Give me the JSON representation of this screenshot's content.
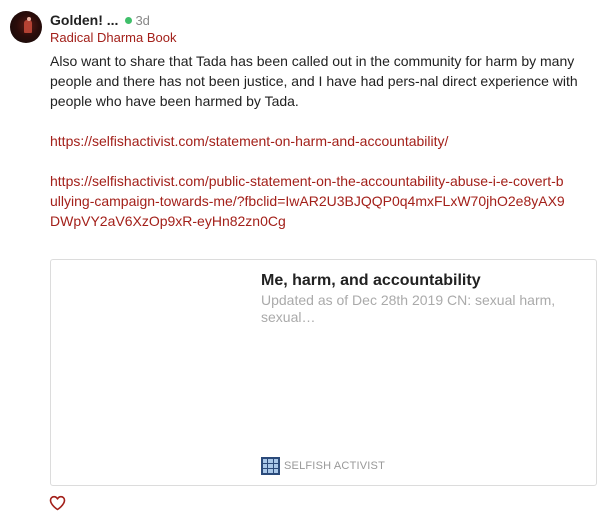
{
  "post": {
    "author": "Golden! ...",
    "time": "3d",
    "community": "Radical Dharma Book",
    "body": "Also want to share that Tada has been called out in the community for harm by many people and there has not been justice, and I have had pers-nal direct experience with people who have been harmed by Tada.",
    "links": [
      "https://selfishactivist.com/statement-on-harm-and-accountability/",
      "https://selfishactivist.com/public-statement-on-the-accountability-abuse-i-e-covert-bullying-campaign-towards-me/?fbclid=IwAR2U3BJQQP0q4mxFLxW70jhO2e8yAX9DWpVY2aV6XzOp9xR-eyHn82zn0Cg"
    ]
  },
  "link_card": {
    "title": "Me, harm, and accountability",
    "description": "Updated as of Dec 28th 2019 CN: sexual harm, sexual…",
    "site_name": "SELFISH ACTIVIST"
  },
  "icons": {
    "online_status": "online-dot-icon",
    "site": "grid-logo-icon",
    "like": "heart-icon"
  },
  "colors": {
    "accent": "#a3201a",
    "online": "#3fbf6a",
    "muted": "#888888",
    "site_icon": "#2b4a7a"
  }
}
